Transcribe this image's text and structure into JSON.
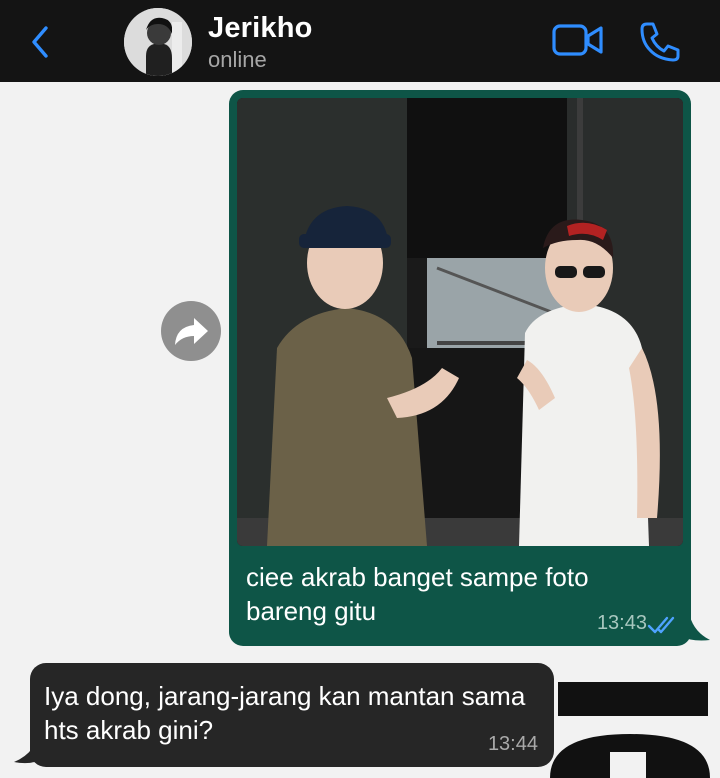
{
  "header": {
    "contact_name": "Jerikho",
    "status": "online",
    "icons": {
      "back": "chevron-left-icon",
      "video": "video-camera-icon",
      "phone": "phone-icon"
    },
    "accent_color": "#2f8dff"
  },
  "messages": [
    {
      "direction": "outgoing",
      "has_photo": true,
      "text": "ciee akrab banget sampe foto bareng gitu",
      "time": "13:43",
      "status_icon": "double-check-read-icon"
    },
    {
      "direction": "incoming",
      "text": "Iya dong, jarang-jarang kan mantan sama hts akrab gini?",
      "time": "13:44"
    }
  ],
  "colors": {
    "outgoing_bubble": "#0e5547",
    "incoming_bubble": "#262626",
    "header_bg": "#141414",
    "chat_bg": "#f2f2f2"
  },
  "forward_icon": "forward-share-icon"
}
